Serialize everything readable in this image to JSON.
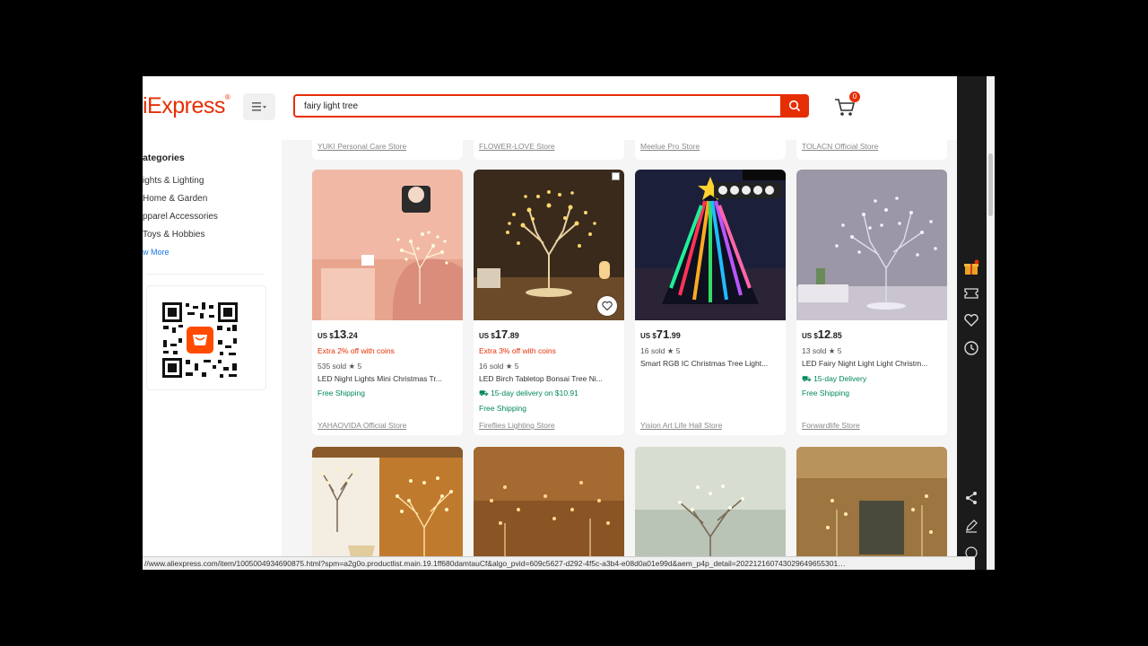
{
  "header": {
    "logo": "iExpress",
    "search_value": "fairy light tree",
    "cart_count": "0"
  },
  "sidebar": {
    "title": "ategories",
    "items": [
      "ights & Lighting",
      "Home & Garden",
      "pparel Accessories",
      "Toys & Hobbies"
    ],
    "view_more": "w More"
  },
  "top_stores": [
    "YUKI Personal Care Store",
    "FLOWER-LOVE Store",
    "Meelue Pro Store",
    "TOLACN Official Store"
  ],
  "products": [
    {
      "currency": "US $",
      "price_whole": "13",
      "price_cents": ".24",
      "coins": "Extra 2% off with coins",
      "sold": "535 sold  ★ 5",
      "title": "LED Night Lights Mini Christmas Tr...",
      "delivery": "",
      "shipping": "Free Shipping",
      "store": "YAHAOVIDA Official Store"
    },
    {
      "currency": "US $",
      "price_whole": "17",
      "price_cents": ".89",
      "coins": "Extra 3% off with coins",
      "sold": "16 sold  ★ 5",
      "title": "LED Birch Tabletop Bonsai Tree Ni...",
      "delivery": "15-day delivery on $10.91",
      "shipping": "Free Shipping",
      "store": "Fireflies Lighting Store"
    },
    {
      "currency": "US $",
      "price_whole": "71",
      "price_cents": ".99",
      "coins": "",
      "sold": "16 sold  ★ 5",
      "title": "Smart RGB IC Christmas Tree Light...",
      "delivery": "",
      "shipping": "",
      "store": "Yision Art Life Hall Store"
    },
    {
      "currency": "US $",
      "price_whole": "12",
      "price_cents": ".85",
      "coins": "",
      "sold": "13 sold  ★ 5",
      "title": "LED Fairy Night Light Light Christm...",
      "delivery": "15-day Delivery",
      "shipping": "Free Shipping",
      "store": "Forwardlife Store"
    }
  ],
  "status_url": "//www.aliexpress.com/item/1005004934690875.html?spm=a2g0o.productlist.main.19.1ff680damtauCf&algo_pvid=609c5627-d292-4f5c-a3b4-e08d0a01e99d&aem_p4p_detail=202212160743029649655301…",
  "colors": {
    "brand": "#e62e04",
    "shipping": "#00875a",
    "rail": "#1b1b1b"
  }
}
